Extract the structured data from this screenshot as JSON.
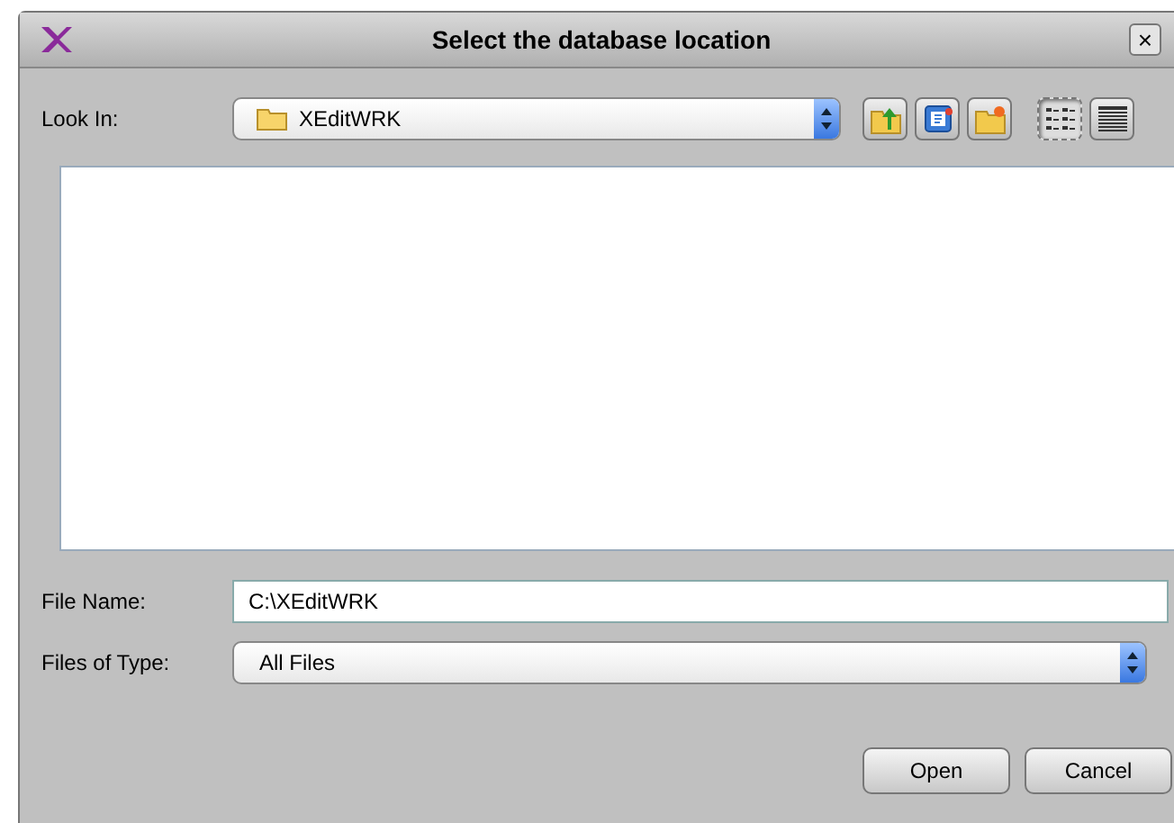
{
  "window": {
    "title": "Select the database location",
    "close": "×"
  },
  "look_in": {
    "label": "Look In:",
    "value": "XEditWRK"
  },
  "toolbar": [
    {
      "kind": "up"
    },
    {
      "kind": "home"
    },
    {
      "kind": "new-folder"
    },
    {
      "kind": "list",
      "selected": true
    },
    {
      "kind": "details",
      "selected": false
    }
  ],
  "file_name": {
    "label": "File Name:",
    "value": "C:\\XEditWRK"
  },
  "files_of_type": {
    "label": "Files of Type:",
    "value": "All Files"
  },
  "buttons": [
    {
      "label": "Open"
    },
    {
      "label": "Cancel"
    }
  ]
}
